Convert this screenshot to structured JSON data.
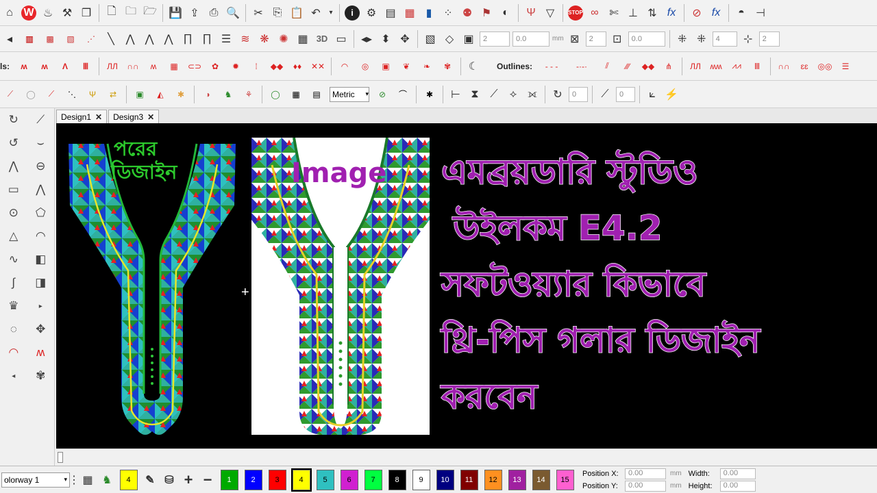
{
  "tabs": [
    {
      "label": "Design1",
      "close": "✕"
    },
    {
      "label": "Design3",
      "close": "✕"
    }
  ],
  "toolbar2": {
    "spin1": "2",
    "spin2": "0.0",
    "unit1": "mm",
    "spin3": "2",
    "spin4": "0.0",
    "spin5": "4",
    "spin6": "2"
  },
  "toolbar3": {
    "satin_label": "ls:",
    "outlines_label": "Outlines:"
  },
  "toolbar4": {
    "units_select": "Metric",
    "spin1": "0",
    "spin2": "0"
  },
  "canvas": {
    "next_design_line1": "পরের",
    "next_design_line2": "ডিজাইন",
    "image_label": "Image",
    "title_lines": [
      "এমব্রয়ডারি স্টুডিও",
      " উইলকম E4.2",
      "সফটওয়্যার কিভাবে",
      "থ্রি-পিস গলার ডিজাইন",
      "করবেন"
    ]
  },
  "bottombar": {
    "colorway": "olorway 1",
    "swatches": [
      {
        "n": "4",
        "color": "#ffff00"
      },
      {
        "n": "1",
        "color": "#00aa00"
      },
      {
        "n": "2",
        "color": "#0000ff"
      },
      {
        "n": "3",
        "color": "#ff0000"
      },
      {
        "n": "4",
        "color": "#ffff00"
      },
      {
        "n": "5",
        "color": "#2fc0c0"
      },
      {
        "n": "6",
        "color": "#d020d0"
      },
      {
        "n": "7",
        "color": "#00ff40"
      },
      {
        "n": "8",
        "color": "#000000"
      },
      {
        "n": "9",
        "color": "#ffffff"
      },
      {
        "n": "10",
        "color": "#000080"
      },
      {
        "n": "11",
        "color": "#800000"
      },
      {
        "n": "12",
        "color": "#ff9020"
      },
      {
        "n": "13",
        "color": "#a020a0"
      },
      {
        "n": "14",
        "color": "#7a5a30"
      },
      {
        "n": "15",
        "color": "#ff60d0"
      }
    ],
    "position_x_label": "Position X:",
    "position_x_value": "0.00",
    "position_y_label": "Position Y:",
    "position_y_value": "0.00",
    "unit": "mm",
    "width_label": "Width:",
    "width_value": "0.00",
    "height_label": "Height:",
    "height_value": "0.00"
  }
}
